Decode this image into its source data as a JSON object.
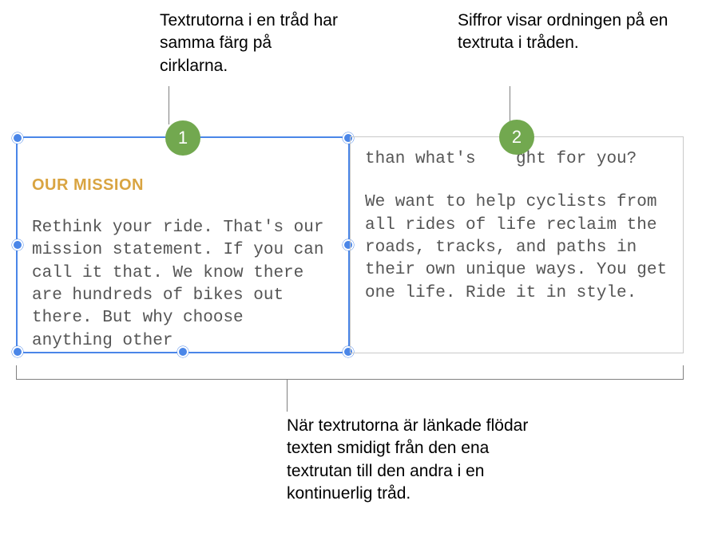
{
  "callouts": {
    "top_left": "Textrutorna i en tråd har samma färg på cirklarna.",
    "top_right": "Siffror visar ordningen på en textruta i tråden.",
    "bottom": "När textrutorna är länkade flödar texten smidigt från den ena textrutan till den andra i en kontinuerlig tråd."
  },
  "badges": {
    "one": "1",
    "two": "2"
  },
  "box1": {
    "heading": "OUR MISSION",
    "body": "Rethink your ride. That's our mission statement. If you can call it that. We know there are hundreds of bikes out there. But why choose anything other"
  },
  "box2": {
    "body_a": "than what's    ght for you?",
    "body_b": "We want to help cyclists from all rides of life reclaim the roads, tracks, and paths in their own unique ways. You get one life. Ride it in style."
  },
  "colors": {
    "badge": "#72a84f",
    "selection": "#4a86e8",
    "heading": "#d9a441"
  }
}
